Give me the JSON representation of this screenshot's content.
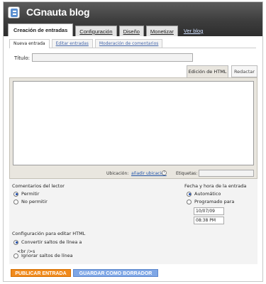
{
  "header": {
    "blog_title": "CGnauta blog",
    "tabs": [
      {
        "label": "Creación de entradas",
        "active": true
      },
      {
        "label": "Configuración",
        "active": false
      },
      {
        "label": "Diseño",
        "active": false
      },
      {
        "label": "Monetizar",
        "active": false
      }
    ],
    "view_blog": "Ver blog"
  },
  "subtabs": [
    {
      "label": "Nueva entrada",
      "active": true
    },
    {
      "label": "Editar entradas",
      "active": false
    },
    {
      "label": "Moderación de comentarios",
      "active": false
    }
  ],
  "post": {
    "title_label": "Título:",
    "title_value": "",
    "mode_html": "Edición de HTML",
    "mode_compose": "Redactar",
    "body": "",
    "location_label": "Ubicación:",
    "location_link": "añadir ubicación",
    "help_glyph": "?",
    "tags_label": "Etiquetas:",
    "tags_value": ""
  },
  "comments": {
    "heading": "Comentarios del lector",
    "options": [
      {
        "label": "Permitir",
        "selected": true
      },
      {
        "label": "No permitir",
        "selected": false
      }
    ]
  },
  "schedule": {
    "heading": "Fecha y hora de la entrada",
    "options": [
      {
        "label": "Automático",
        "selected": true
      },
      {
        "label": "Programado para",
        "selected": false
      }
    ],
    "date": "10/07/09",
    "time": "08:38 PM"
  },
  "html_config": {
    "heading": "Configuración para editar HTML",
    "options": [
      {
        "label": "Convertir saltos de línea a",
        "selected": true
      },
      {
        "label": "Ignorar saltos de línea",
        "selected": false
      }
    ],
    "break_tag": "<br />s"
  },
  "buttons": {
    "publish": "PUBLICAR ENTRADA",
    "draft": "GUARDAR COMO BORRADOR"
  },
  "colors": {
    "header_bg": "#3d3d3d",
    "publish": "#f08a1c",
    "draft": "#7fa7e6",
    "link": "#2255aa"
  }
}
